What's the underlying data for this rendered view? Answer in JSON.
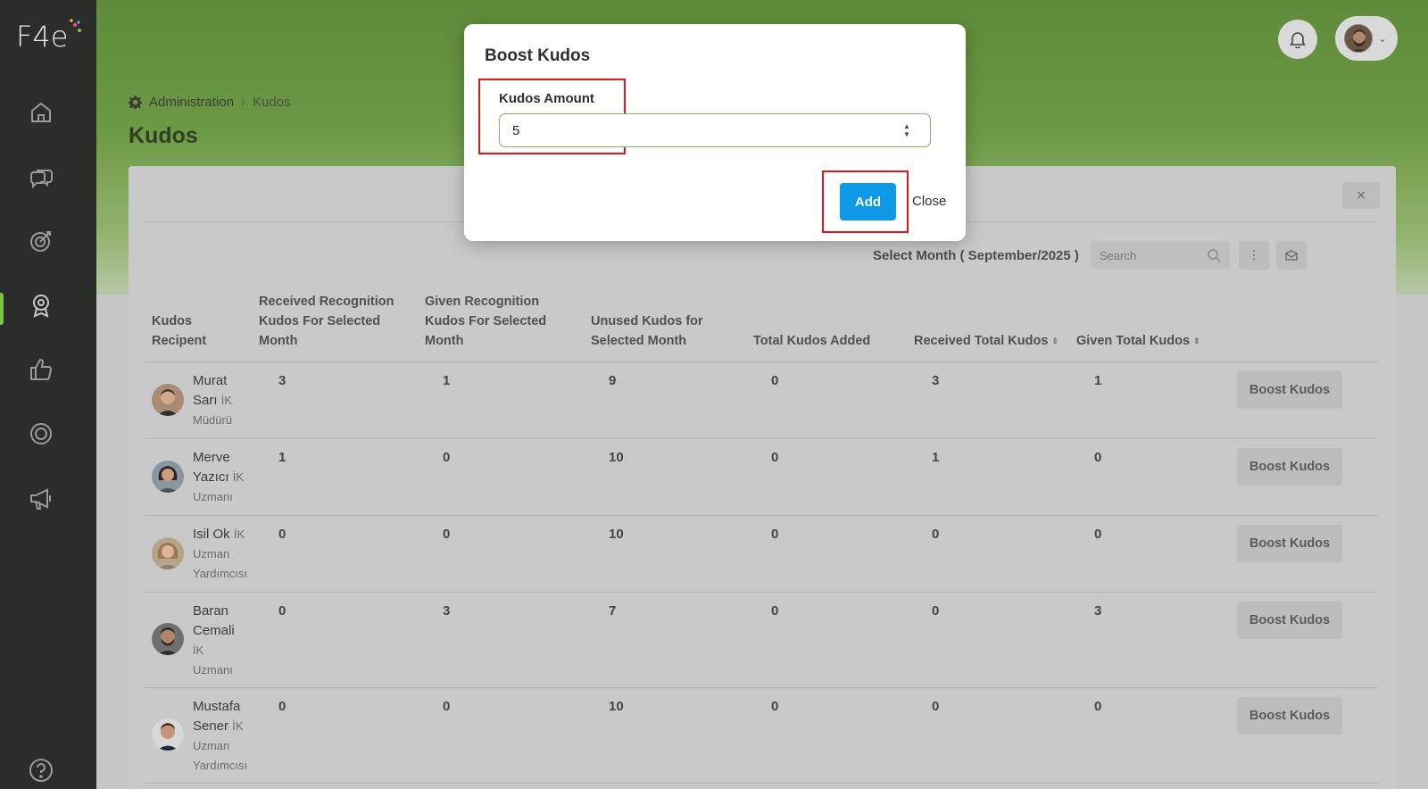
{
  "app": {
    "logo_text": "F4e"
  },
  "sidebar": {
    "items": [
      {
        "icon": "home-icon"
      },
      {
        "icon": "chat-bubbles-icon"
      },
      {
        "icon": "target-icon"
      },
      {
        "icon": "award-badge-icon",
        "active": true
      },
      {
        "icon": "thumbs-up-icon"
      },
      {
        "icon": "settings-ring-icon"
      },
      {
        "icon": "megaphone-icon"
      }
    ],
    "help_icon": "help-icon",
    "accent_color": "#7fc24a"
  },
  "header": {
    "notification_icon": "bell-icon",
    "avatar_icon": "user-avatar"
  },
  "breadcrumb": {
    "root": "Administration",
    "current": "Kudos"
  },
  "page": {
    "title": "Kudos"
  },
  "toolbar": {
    "month_label": "Select Month ( September/2025 )",
    "search_placeholder": "Search",
    "close_symbol": "×"
  },
  "table": {
    "headers": {
      "recipient": [
        "Kudos",
        "Recipent"
      ],
      "received_month": [
        "Received Recognition",
        "Kudos For Selected",
        "Month"
      ],
      "given_month": [
        "Given Recognition",
        "Kudos For Selected",
        "Month"
      ],
      "unused": [
        "Unused Kudos for",
        "Selected Month"
      ],
      "total_added": "Total Kudos Added",
      "received_total": "Received Total Kudos",
      "given_total": "Given Total Kudos"
    },
    "rows": [
      {
        "name": [
          "Murat",
          "Sarı"
        ],
        "role": [
          "İK",
          "Müdürü"
        ],
        "received_month": "3",
        "given_month": "1",
        "unused": "9",
        "total_added": "0",
        "received_total": "3",
        "given_total": "1",
        "action": "Boost Kudos"
      },
      {
        "name": [
          "Merve",
          "Yazıcı"
        ],
        "role": [
          "İK",
          "Uzmanı"
        ],
        "received_month": "1",
        "given_month": "0",
        "unused": "10",
        "total_added": "0",
        "received_total": "1",
        "given_total": "0",
        "action": "Boost Kudos"
      },
      {
        "name": [
          "Isil Ok"
        ],
        "role": [
          "İK",
          "Uzman",
          "Yardımcısı"
        ],
        "received_month": "0",
        "given_month": "0",
        "unused": "10",
        "total_added": "0",
        "received_total": "0",
        "given_total": "0",
        "action": "Boost Kudos"
      },
      {
        "name": [
          "Baran",
          "Cemali"
        ],
        "role": [
          "İK",
          "Uzmanı"
        ],
        "received_month": "0",
        "given_month": "3",
        "unused": "7",
        "total_added": "0",
        "received_total": "0",
        "given_total": "3",
        "action": "Boost Kudos"
      },
      {
        "name": [
          "Mustafa",
          "Sener"
        ],
        "role": [
          "İK",
          "Uzman",
          "Yardımcısı"
        ],
        "received_month": "0",
        "given_month": "0",
        "unused": "10",
        "total_added": "0",
        "received_total": "0",
        "given_total": "0",
        "action": "Boost Kudos"
      }
    ]
  },
  "modal": {
    "title": "Boost Kudos",
    "field_label": "Kudos Amount",
    "field_value": "5",
    "add_label": "Add",
    "close_label": "Close",
    "input_border_color": "#7fb36a",
    "add_button_color": "#0d99e8",
    "highlight_color": "#e3161b"
  }
}
